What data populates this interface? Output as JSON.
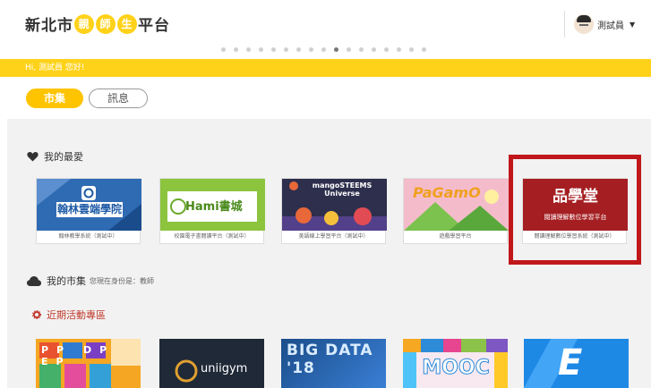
{
  "header": {
    "brand_prefix": "新北市",
    "brand_c1": "親",
    "brand_c2": "師",
    "brand_c3": "生",
    "brand_suffix": "平台",
    "user_name": "測試員",
    "caret": "▼"
  },
  "banner": {
    "greeting": "Hi, 測試員 您好!"
  },
  "tabs": [
    {
      "label": "市集"
    },
    {
      "label": "訊息"
    }
  ],
  "favorites": {
    "title": "我的最愛",
    "cards": [
      {
        "name": "翰林雲端學院",
        "caption": "翰林教學系統（測試中）"
      },
      {
        "name": "Hami書城",
        "caption": "校園電子書閱讀平台（測試中）"
      },
      {
        "name": "mangoSTEEMS Universe",
        "caption": "美語線上學習平台（測試中）"
      },
      {
        "name": "PaGamO",
        "caption": "遊戲學習平台"
      },
      {
        "name": "品學堂",
        "sub": "閱讀理解數位學習平台",
        "caption": "閱讀理解數位學習系統（測試中）"
      }
    ]
  },
  "market": {
    "title": "我的市集",
    "role": "您現在身份是：教師"
  },
  "events": {
    "title": "近期活動專區"
  },
  "tiles": [
    {
      "name": "PP DP EP"
    },
    {
      "name": "uniigym"
    },
    {
      "name": "BIG DATA '18"
    },
    {
      "name": "MOOC"
    },
    {
      "name": "E"
    }
  ],
  "colors": {
    "accent": "#ffd21a",
    "highlight": "#c0171b",
    "page_bg": "#f2f2f2"
  }
}
